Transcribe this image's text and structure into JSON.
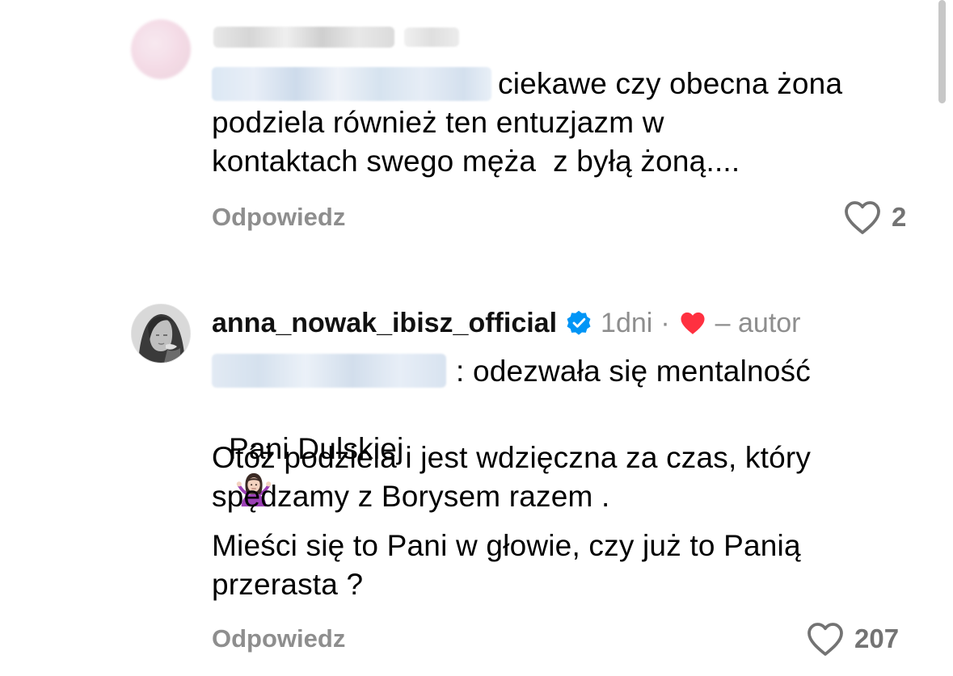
{
  "comments": [
    {
      "text": "ciekawe czy obecna żona\npodziela również ten entuzjazm w\nkontaktach swego męża  z byłą żoną....",
      "reply_label": "Odpowiedz",
      "like_count": "2"
    },
    {
      "author": "anna_nowak_ibisz_official",
      "time": "1dni",
      "separator": "·",
      "author_tag": "– autor",
      "line1": ": odezwała się mentalność",
      "line2": "Pani Dulskiej",
      "paragraph2": "Otóż podziela i jest wdzięczna za czas, który\nspędzamy z Borysem razem .",
      "paragraph3": "Mieści się to Pani w głowie, czy już to Panią\nprzerasta ?",
      "reply_label": "Odpowiedz",
      "like_count": "207",
      "emoji": "person-shrugging"
    }
  ],
  "colors": {
    "secondary_text": "#8e8e8e",
    "verified_blue": "#0095f6",
    "like_red": "#ff3040"
  }
}
